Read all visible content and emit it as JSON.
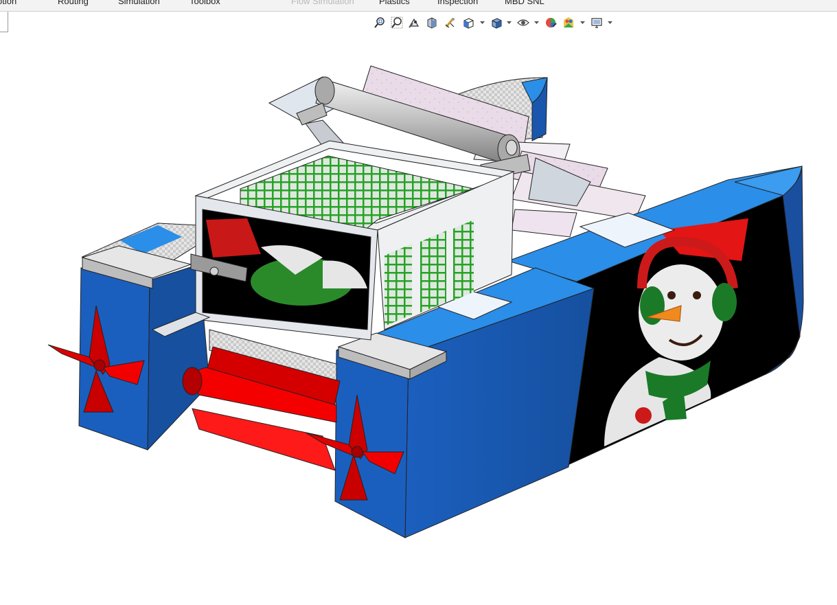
{
  "ribbon": {
    "tabs": [
      {
        "label": "otion",
        "disabled": false
      },
      {
        "label": "Routing",
        "disabled": false
      },
      {
        "label": "Simulation",
        "disabled": false
      },
      {
        "label": "Toolbox",
        "disabled": false
      },
      {
        "label": "Flow Simulation",
        "disabled": true
      },
      {
        "label": "Plastics",
        "disabled": false
      },
      {
        "label": "Inspection",
        "disabled": false
      },
      {
        "label": "MBD SNL",
        "disabled": false
      }
    ]
  },
  "view_toolbar": {
    "icons": [
      "zoom-to-fit-icon",
      "zoom-to-area-icon",
      "previous-view-icon",
      "section-view-icon",
      "dynamic-annotation-icon",
      "view-orientation-icon",
      "display-style-icon",
      "hide-show-items-icon",
      "edit-appearance-icon",
      "apply-scene-icon",
      "view-settings-icon"
    ]
  },
  "colors": {
    "hull_blue": "#1b5fbe",
    "hull_blue_light": "#2b8ee8",
    "hull_blue_dark": "#123f8a",
    "frame_gray": "#d9dde3",
    "basket_green": "#27a327",
    "propeller_red": "#e00000",
    "decal_black": "#000000"
  }
}
